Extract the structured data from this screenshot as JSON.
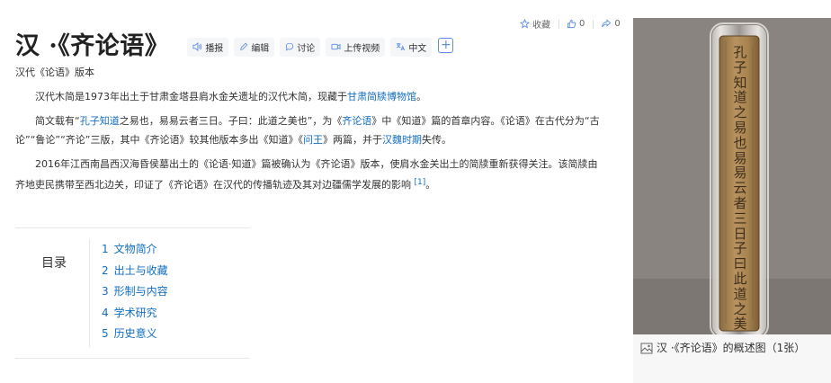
{
  "actions": {
    "favorite_label": "收藏",
    "like_count": "0",
    "share_count": "0"
  },
  "title": "汉 ·《齐论语》",
  "toolbar": {
    "play": "播报",
    "edit": "编辑",
    "discuss": "讨论",
    "upload": "上传视频",
    "lang": "中文",
    "add": "+"
  },
  "subtitle": "汉代《论语》版本",
  "para1": {
    "t1": "汉代木简是1973年出土于甘肃金塔县肩水金关遗址的汉代木简，现藏于",
    "link1": "甘肃简牍博物馆",
    "t2": "。"
  },
  "para2": {
    "t1": "简文载有“",
    "link1": "孔子知道",
    "t2": "之易也，易易云者三日。子曰：此道之美也”，为《",
    "link2": "齐论语",
    "t3": "》中《知道》篇的首章内容。《论语》在古代分为“古论”“鲁论”“齐论”三版，其中《齐论语》较其他版本多出《知道》《",
    "link3": "问王",
    "t4": "》两篇，并于",
    "link4": "汉魏时期",
    "t5": "失传。"
  },
  "para3": {
    "t1": "2016年江西南昌西汉海昏侯墓出土的《论语·知道》篇被确认为《齐论语》版本，使肩水金关出土的简牍重新获得关注。该简牍由齐地吏民携带至西北边关，印证了《齐论语》在汉代的传播轨迹及其对边疆儒学发展的影响",
    "ref": "[1]",
    "t2": "。"
  },
  "toc": {
    "title": "目录",
    "items": [
      {
        "num": "1",
        "label": "文物简介"
      },
      {
        "num": "2",
        "label": "出土与收藏"
      },
      {
        "num": "3",
        "label": "形制与内容"
      },
      {
        "num": "4",
        "label": "学术研究"
      },
      {
        "num": "5",
        "label": "历史意义"
      }
    ]
  },
  "album": {
    "caption": "汉 ·《齐论语》的概述图（1张）",
    "slip_text": "孔子知道之易也易易云者三日子曰此道之美"
  },
  "colors": {
    "link": "#136ec2",
    "accent": "#5b8ee6"
  }
}
